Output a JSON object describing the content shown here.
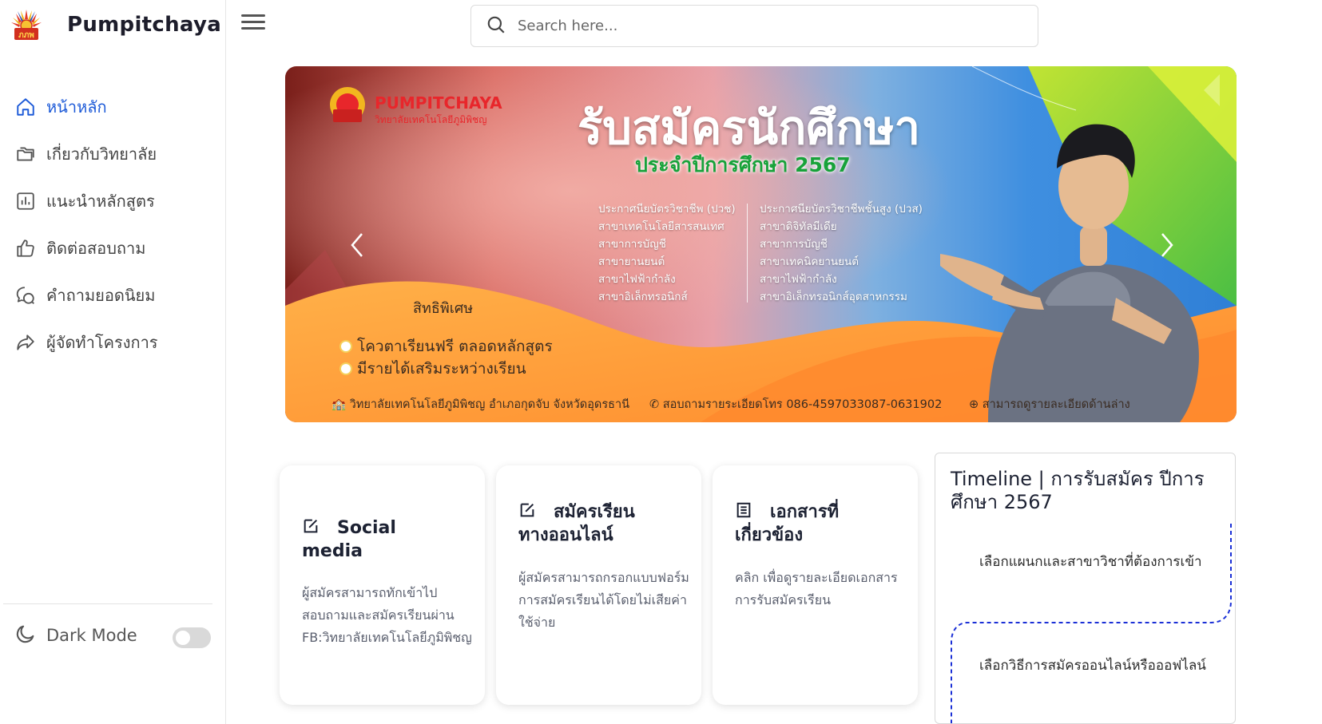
{
  "brand": {
    "name": "Pumpitchaya",
    "logo_icon": "college-emblem-icon"
  },
  "nav": {
    "items": [
      {
        "label": "หน้าหลัก",
        "icon": "home-icon",
        "active": true
      },
      {
        "label": "เกี่ยวกับวิทยาลัย",
        "icon": "folders-icon",
        "active": false
      },
      {
        "label": "แนะนำหลักสูตร",
        "icon": "chart-icon",
        "active": false
      },
      {
        "label": "ติดต่อสอบถาม",
        "icon": "thumbs-up-icon",
        "active": false
      },
      {
        "label": "คำถามยอดนิยม",
        "icon": "chat-icon",
        "active": false
      },
      {
        "label": "ผู้จัดทำโครงการ",
        "icon": "share-icon",
        "active": false
      }
    ],
    "dark_mode_label": "Dark Mode",
    "dark_mode_on": false
  },
  "search": {
    "placeholder": "Search here..."
  },
  "banner": {
    "brand": "PUMPITCHAYA",
    "brand_sub": "วิทยาลัยเทคโนโลยีภูมิพิชญ",
    "title": "รับสมัครนักศึกษา",
    "subtitle": "ประจำปีการศึกษา 2567",
    "col1": [
      "ประกาศนียบัตรวิชาชีพ (ปวช)",
      "สาขาเทคโนโลยีสารสนเทศ",
      "สาขาการบัญชี",
      "สาขายานยนต์",
      "สาขาไฟฟ้ากำลัง",
      "สาขาอิเล็กทรอนิกส์"
    ],
    "col2": [
      "ประกาศนียบัตรวิชาชีพชั้นสูง (ปวส)",
      "สาขาดิจิทัลมีเดีย",
      "สาขาการบัญชี",
      "สาขาเทคนิคยานยนต์",
      "สาขาไฟฟ้ากำลัง",
      "สาขาอิเล็กทรอนิกส์อุตสาหกรรม"
    ],
    "privilege_title": "สิทธิพิเศษ",
    "privileges": [
      "โควตาเรียนฟรี ตลอดหลักสูตร",
      "มีรายได้เสริมระหว่างเรียน"
    ],
    "footer": {
      "address": "วิทยาลัยเทคโนโลยีภูมิพิชญ อำเภอกุดจับ จังหวัดอุดรธานี",
      "phone": "สอบถามรายระเอียดโทร 086-4597033087-0631902",
      "more": "สามารถดูรายละเอียดด้านล่าง"
    }
  },
  "cards": [
    {
      "icon": "edit-icon",
      "title_line1": "Social",
      "title_line2": "media",
      "desc": "ผู้สมัครสามารถทักเข้าไปสอบถามและสมัครเรียนผ่าน FB:วิทยาลัยเทคโนโลยีภูมิพิชญ"
    },
    {
      "icon": "edit-icon",
      "title_line1": "สมัครเรียน",
      "title_line2": "ทางออนไลน์",
      "desc": "ผู้สมัครสามารถกรอกแบบฟอร์มการสมัครเรียนได้โดยไม่เสียค่าใช้จ่าย"
    },
    {
      "icon": "document-icon",
      "title_line1": "เอกสารที่",
      "title_line2": "เกี่ยวข้อง",
      "desc": "คลิก เพื่อดูรายละเอียดเอกสารการรับสมัครเรียน"
    }
  ],
  "timeline": {
    "title": "Timeline | การรับสมัคร ปีการศึกษา 2567",
    "steps": [
      "เลือกแผนกและสาขาวิชาที่ต้องการเข้า",
      "เลือกวิธีการสมัครออนไลน์หรือออฟไลน์"
    ]
  }
}
